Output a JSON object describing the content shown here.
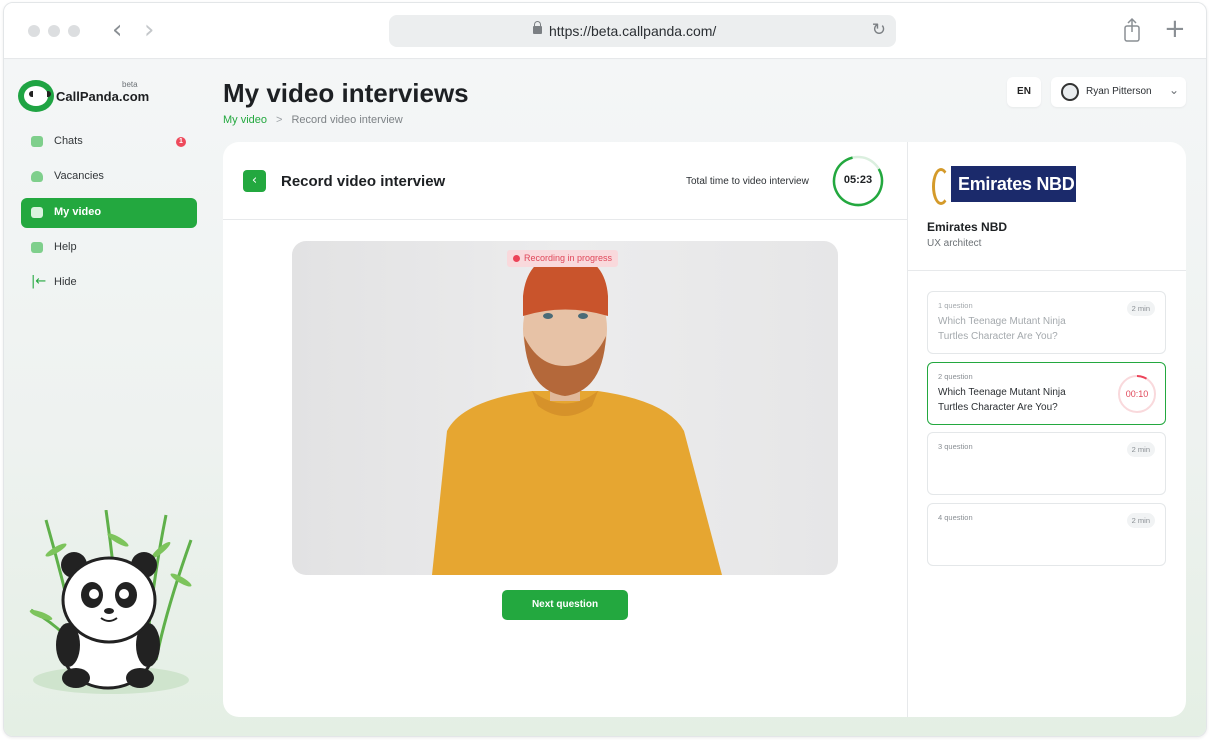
{
  "browser": {
    "url": "https://beta.callpanda.com/"
  },
  "brand": {
    "name": "CallPanda.com",
    "tag": "beta"
  },
  "sidebar": {
    "items": [
      {
        "label": "Chats",
        "badge": "1"
      },
      {
        "label": "Vacancies"
      },
      {
        "label": "My video",
        "active": true
      },
      {
        "label": "Help"
      },
      {
        "label": "Hide"
      }
    ]
  },
  "header": {
    "title": "My video interviews",
    "breadcrumb": {
      "root": "My video",
      "separator": ">",
      "current": "Record video interview"
    },
    "language": "EN",
    "user": "Ryan Pitterson"
  },
  "interview": {
    "title": "Record video interview",
    "total_time_label": "Total time to video interview",
    "total_time": "05:23",
    "recording_status": "Recording in progress",
    "next_button": "Next question"
  },
  "company": {
    "logo_text": "Emirates NBD",
    "name": "Emirates NBD",
    "role": "UX architect"
  },
  "questions": [
    {
      "number": "1 question",
      "text": "Which Teenage Mutant Ninja Turtles Character Are You?",
      "duration": "2 min",
      "state": "done"
    },
    {
      "number": "2 question",
      "text": "Which Teenage Mutant Ninja Turtles Character Are You?",
      "timer": "00:10",
      "state": "active"
    },
    {
      "number": "3 question",
      "text": "",
      "duration": "2 min",
      "state": "pending"
    },
    {
      "number": "4 question",
      "text": "",
      "duration": "2 min",
      "state": "pending"
    }
  ],
  "colors": {
    "accent": "#23a83f",
    "recording": "#ec4358",
    "company_blue": "#1b2a6b"
  }
}
